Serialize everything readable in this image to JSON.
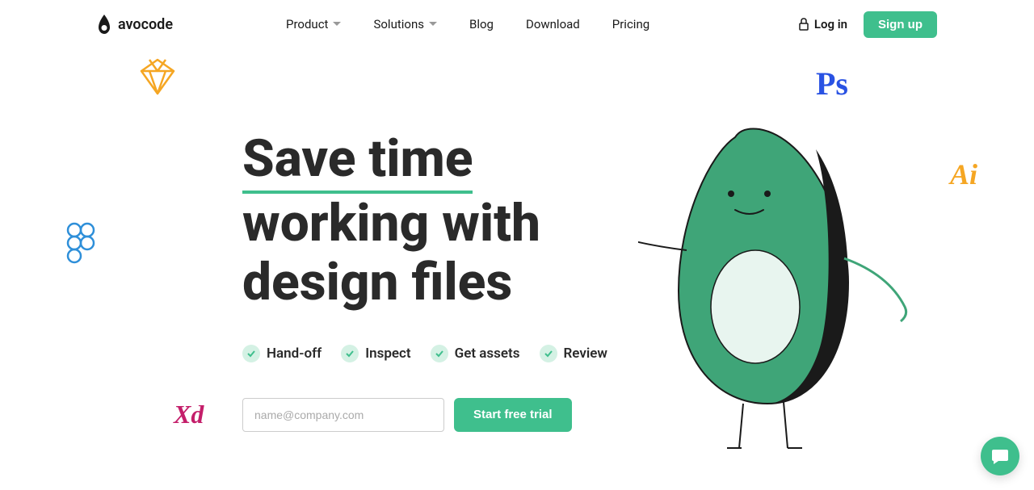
{
  "logo": {
    "text": "avocode"
  },
  "nav": {
    "product": "Product",
    "solutions": "Solutions",
    "blog": "Blog",
    "download": "Download",
    "pricing": "Pricing"
  },
  "header": {
    "login": "Log in",
    "signup": "Sign up"
  },
  "hero": {
    "title_line1": "Save time",
    "title_line2": "working with",
    "title_line3": "design files"
  },
  "features": {
    "f0": "Hand-off",
    "f1": "Inspect",
    "f2": "Get assets",
    "f3": "Review"
  },
  "form": {
    "email_placeholder": "name@company.com",
    "trial_button": "Start free trial"
  },
  "deco": {
    "xd": "Xd",
    "ps": "Ps",
    "ai": "Ai"
  }
}
